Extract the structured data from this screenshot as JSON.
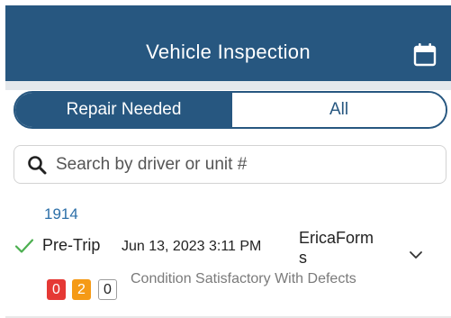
{
  "header": {
    "title": "Vehicle Inspection",
    "calendar_icon": "calendar-icon",
    "background": "#275780"
  },
  "filter": {
    "options": [
      "Repair Needed",
      "All"
    ],
    "selected": "Repair Needed"
  },
  "search": {
    "placeholder": "Search by driver or unit #",
    "value": "",
    "icon": "search-icon"
  },
  "inspections": [
    {
      "unit": "1914",
      "status_icon": "check-icon",
      "type": "Pre-Trip",
      "date": "Jun 13, 2023 3:11 PM",
      "driver": "EricaForms",
      "defect_counts": {
        "red": "0",
        "orange": "2",
        "grey": "0"
      },
      "condition": "Condition Satisfactory With Defects",
      "expand_icon": "chevron-down-icon"
    }
  ],
  "colors": {
    "accent": "#275780",
    "check": "#4caf50",
    "badge_red": "#e53935",
    "badge_orange": "#f59a16",
    "unit_link": "#2c6fa8"
  }
}
